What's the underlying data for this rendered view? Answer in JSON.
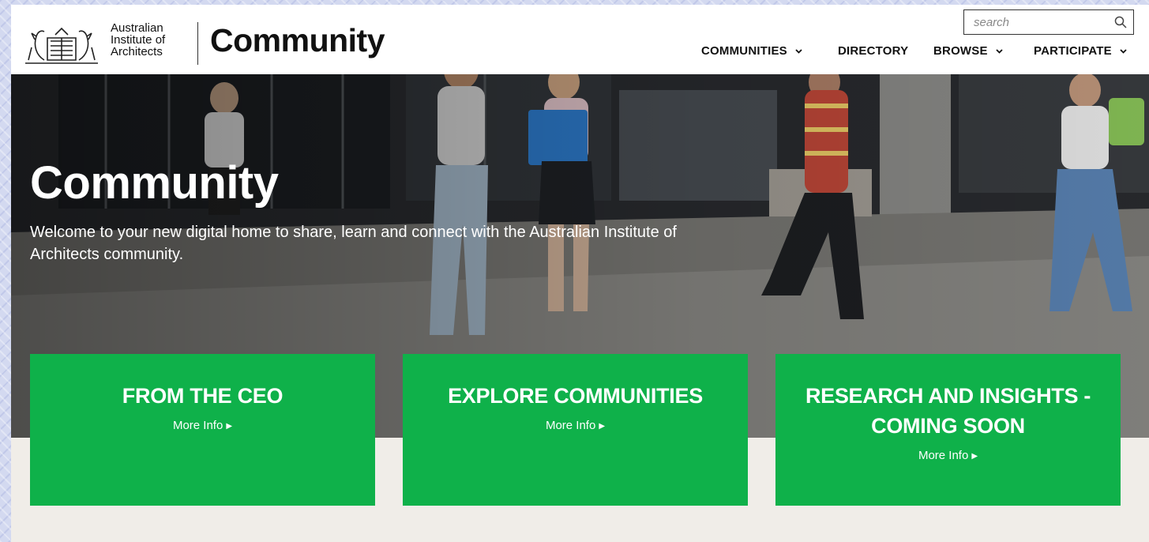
{
  "brand": {
    "org_line1": "Australian",
    "org_line2": "Institute of",
    "org_line3": "Architects",
    "title": "Community"
  },
  "search": {
    "placeholder": "search",
    "icon": "search-icon"
  },
  "nav": {
    "items": [
      {
        "label": "COMMUNITIES",
        "has_dropdown": true
      },
      {
        "label": "DIRECTORY",
        "has_dropdown": false
      },
      {
        "label": "BROWSE",
        "has_dropdown": true
      },
      {
        "label": "PARTICIPATE",
        "has_dropdown": true
      }
    ]
  },
  "hero": {
    "title": "Community",
    "subtitle": "Welcome to your new digital home to share, learn and connect with the Australian Institute of Architects community."
  },
  "cards": [
    {
      "title": "FROM THE CEO",
      "link": "More Info"
    },
    {
      "title": "EXPLORE COMMUNITIES",
      "link": "More Info"
    },
    {
      "title": "RESEARCH AND INSIGHTS - COMING SOON",
      "link": "More Info"
    }
  ],
  "colors": {
    "accent_green": "#0fb14a",
    "text_dark": "#111111",
    "page_bg": "#f0ede8"
  }
}
